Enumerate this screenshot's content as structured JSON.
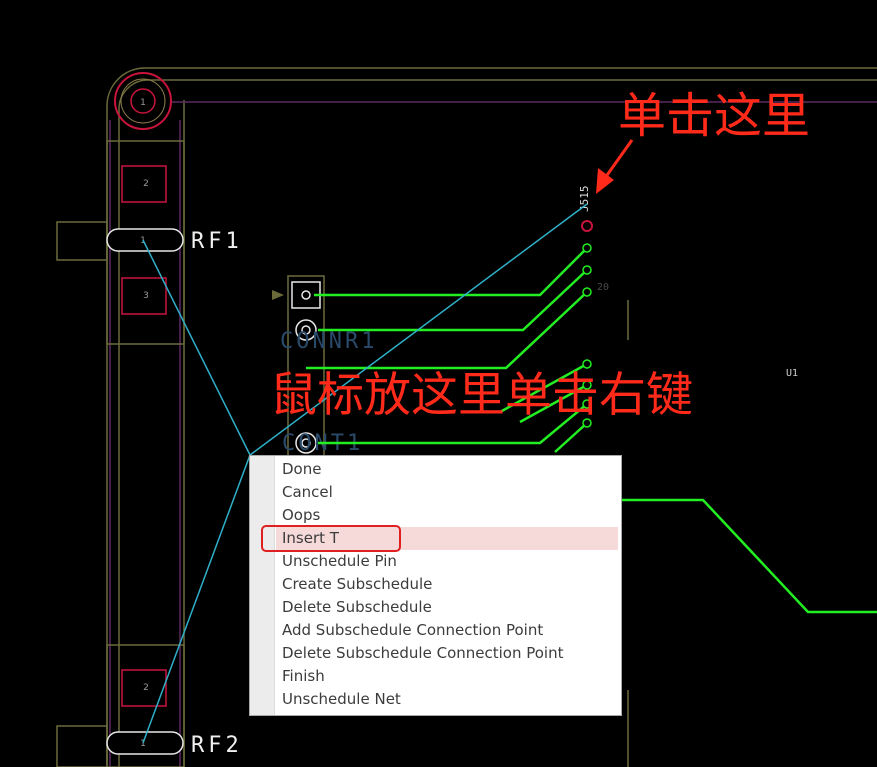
{
  "pcb": {
    "labels": {
      "rf1": "RF1",
      "rf2": "RF2",
      "u1": "U1",
      "conn": "CONNR1",
      "conn2": "CONT1",
      "top_ref": "J515",
      "pad_top": "1",
      "pad_mid2": "2",
      "pad_mid3": "3",
      "rf1_pad": "1",
      "rf2_pad": "1",
      "pad_bottom2": "2",
      "pin_20": "20"
    },
    "colors": {
      "background": "#000000",
      "outline": "#6b6b3a",
      "trace": "#22ee22",
      "ratsnest": "#2fb0c8",
      "pad_red": "#c8143c",
      "board_edge": "#5a2a60"
    }
  },
  "annotations": {
    "click_here": "单击这里",
    "right_click_here": "鼠标放这里单击右键"
  },
  "context_menu": {
    "items": [
      "Done",
      "Cancel",
      "Oops",
      "Insert T",
      "Unschedule Pin",
      "Create Subschedule",
      "Delete Subschedule",
      "Add Subschedule Connection Point",
      "Delete Subschedule Connection Point",
      "Finish",
      "Unschedule Net"
    ],
    "highlighted_index": 3
  }
}
